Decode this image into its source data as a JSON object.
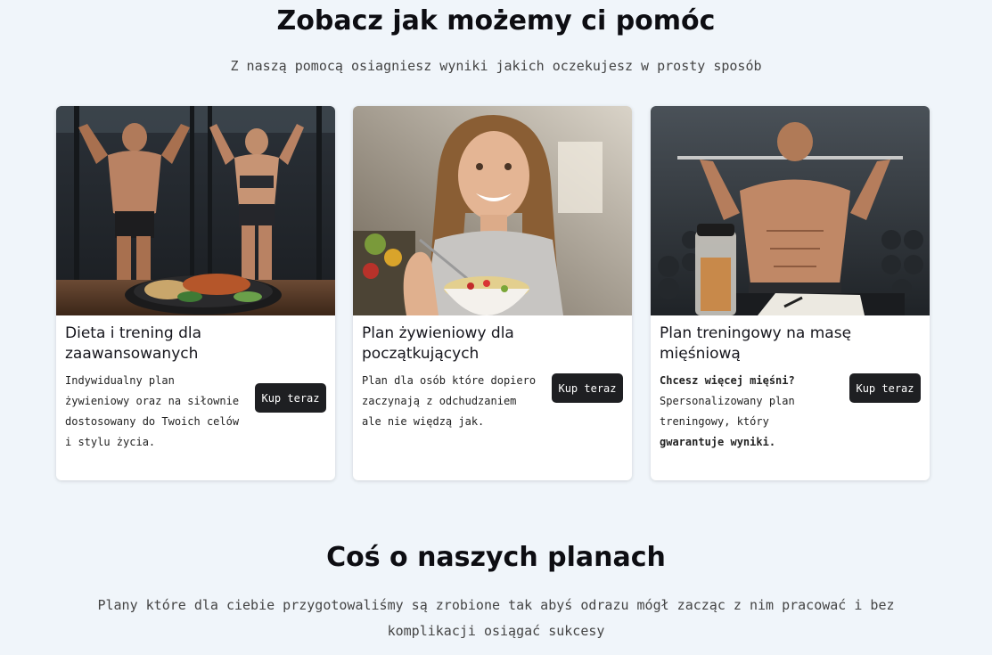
{
  "section1": {
    "title": "Zobacz jak możemy ci pomóc",
    "subtitle": "Z naszą pomocą osiagniesz wyniki jakich oczekujesz w prosty sposób"
  },
  "cards": [
    {
      "title": "Dieta i trening dla zaawansowanych",
      "description": "Indywidualny plan żywieniowy oraz na siłownie dostosowany do Twoich celów i stylu życia.",
      "button_label": "Kup teraz"
    },
    {
      "title": "Plan żywieniowy dla początkujących",
      "description": "Plan dla osób które dopiero zaczynają z odchudzaniem ale nie więdzą jak.",
      "button_label": "Kup teraz"
    },
    {
      "title": "Plan treningowy na masę mięśniową",
      "description_intro": "Chcesz więcej mięśni?",
      "description_body": "Spersonalizowany plan treningowy, który",
      "description_emphasis": "gwarantuje wyniki.",
      "button_label": "Kup teraz"
    }
  ],
  "section2": {
    "title": "Coś o naszych planach",
    "subtitle": "Plany które dla ciebie przygotowaliśmy są zrobione tak abyś odrazu mógł zacząc z nim pracować i bez komplikacji osiągać sukcesy"
  },
  "colors": {
    "page_background": "#f0f5fa",
    "button_background": "#1e1f22",
    "button_text": "#ffffff"
  }
}
